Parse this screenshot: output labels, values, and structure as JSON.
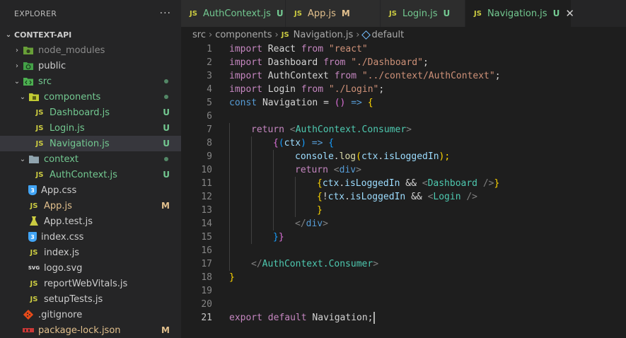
{
  "explorer": {
    "title": "EXPLORER",
    "more": "···",
    "project": "CONTEXT-API",
    "items": [
      {
        "label": "node_modules",
        "status": ""
      },
      {
        "label": "public",
        "status": ""
      },
      {
        "label": "src",
        "status": ""
      },
      {
        "label": "components",
        "status": ""
      },
      {
        "label": "Dashboard.js",
        "status": "U"
      },
      {
        "label": "Login.js",
        "status": "U"
      },
      {
        "label": "Navigation.js",
        "status": "U"
      },
      {
        "label": "context",
        "status": ""
      },
      {
        "label": "AuthContext.js",
        "status": "U"
      },
      {
        "label": "App.css",
        "status": ""
      },
      {
        "label": "App.js",
        "status": "M"
      },
      {
        "label": "App.test.js",
        "status": ""
      },
      {
        "label": "index.css",
        "status": ""
      },
      {
        "label": "index.js",
        "status": ""
      },
      {
        "label": "logo.svg",
        "status": ""
      },
      {
        "label": "reportWebVitals.js",
        "status": ""
      },
      {
        "label": "setupTests.js",
        "status": ""
      },
      {
        "label": ".gitignore",
        "status": ""
      },
      {
        "label": "package-lock.json",
        "status": "M"
      }
    ]
  },
  "tabs": [
    {
      "label": "AuthContext.js",
      "status": "U"
    },
    {
      "label": "App.js",
      "status": "M"
    },
    {
      "label": "Login.js",
      "status": "U"
    },
    {
      "label": "Navigation.js",
      "status": "U",
      "close": "✕"
    }
  ],
  "breadcrumb": [
    "src",
    "components",
    "Navigation.js",
    "default"
  ],
  "icon_text": {
    "js": "JS",
    "css": "3",
    "svg": "SVG"
  },
  "editor": {
    "line_numbers": [
      "1",
      "2",
      "3",
      "4",
      "5",
      "6",
      "7",
      "8",
      "9",
      "10",
      "11",
      "12",
      "13",
      "14",
      "15",
      "16",
      "17",
      "18",
      "19",
      "20",
      "21"
    ],
    "tokens": {
      "l1": [
        "import",
        " React ",
        "from",
        " ",
        "\"react\""
      ],
      "l2": [
        "import",
        " Dashboard ",
        "from",
        " ",
        "\"./Dashboard\"",
        ";"
      ],
      "l3": [
        "import",
        " AuthContext ",
        "from",
        " ",
        "\"../context/AuthContext\"",
        ";"
      ],
      "l4": [
        "import",
        " Login ",
        "from",
        " ",
        "\"./Login\"",
        ";"
      ],
      "l5": [
        "const",
        " ",
        "Navigation",
        " = ",
        "()",
        " ",
        "=>",
        " ",
        "{"
      ],
      "l7": [
        "return",
        " ",
        "<",
        "AuthContext.Consumer",
        ">"
      ],
      "l8": [
        "{",
        "(",
        "ctx",
        ")",
        " ",
        "=>",
        " ",
        "{"
      ],
      "l9": [
        "console",
        ".",
        "log",
        "(",
        "ctx",
        ".",
        "isLoggedIn",
        ");"
      ],
      "l10": [
        "return",
        " ",
        "<",
        "div",
        ">"
      ],
      "l11": [
        "{",
        "ctx",
        ".",
        "isLoggedIn",
        " && ",
        "<",
        "Dashboard",
        " />",
        "}"
      ],
      "l12": [
        "{",
        "!",
        "ctx",
        ".",
        "isLoggedIn",
        " && ",
        "<",
        "Login",
        " />"
      ],
      "l13": [
        "}"
      ],
      "l14": [
        "</",
        "div",
        ">"
      ],
      "l15": [
        "}",
        "}"
      ],
      "l17": [
        "</",
        "AuthContext.Consumer",
        ">"
      ],
      "l18": [
        "}"
      ],
      "l21": [
        "export",
        " ",
        "default",
        " Navigation;"
      ]
    }
  },
  "colors": {
    "untracked": "#73c991",
    "modified": "#e2c08d",
    "keyword": "#569cd6",
    "control": "#c586c0",
    "string": "#ce9178",
    "variable": "#9cdcfe",
    "function": "#dcdcaa",
    "component": "#4ec9b0"
  }
}
